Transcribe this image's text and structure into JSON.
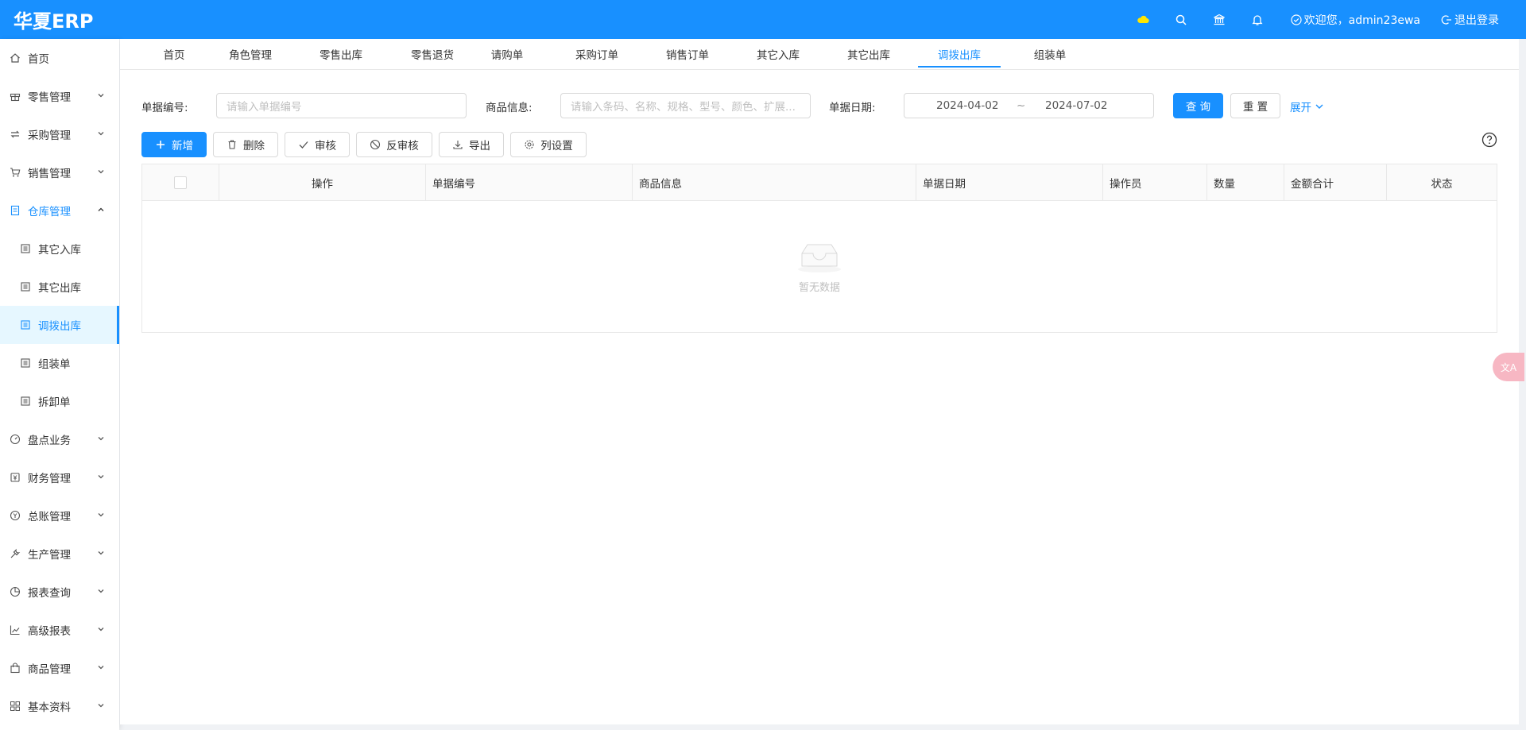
{
  "header": {
    "logo": "华夏ERP",
    "welcome": "欢迎您，admin23ewa",
    "logout": "退出登录",
    "icons": [
      "cloud-icon",
      "search-icon",
      "bank-icon",
      "bell-icon"
    ]
  },
  "sidebar": {
    "items": [
      {
        "label": "首页",
        "icon": "home-icon"
      },
      {
        "label": "零售管理",
        "icon": "gift-icon"
      },
      {
        "label": "采购管理",
        "icon": "swap-icon"
      },
      {
        "label": "销售管理",
        "icon": "cart-icon"
      },
      {
        "label": "仓库管理",
        "icon": "file-icon"
      },
      {
        "label": "盘点业务",
        "icon": "dashboard-icon"
      },
      {
        "label": "财务管理",
        "icon": "money-icon"
      },
      {
        "label": "总账管理",
        "icon": "money-collect-icon"
      },
      {
        "label": "生产管理",
        "icon": "tool-icon"
      },
      {
        "label": "报表查询",
        "icon": "pie-chart-icon"
      },
      {
        "label": "高级报表",
        "icon": "line-chart-icon"
      },
      {
        "label": "商品管理",
        "icon": "shopping-icon"
      },
      {
        "label": "基本资料",
        "icon": "appstore-icon"
      }
    ],
    "warehouse_sub": [
      {
        "label": "其它入库"
      },
      {
        "label": "其它出库"
      },
      {
        "label": "调拨出库"
      },
      {
        "label": "组装单"
      },
      {
        "label": "拆卸单"
      }
    ]
  },
  "tabs": [
    "首页",
    "角色管理",
    "零售出库",
    "零售退货",
    "请购单",
    "采购订单",
    "销售订单",
    "其它入库",
    "其它出库",
    "调拨出库",
    "组装单"
  ],
  "search": {
    "bill_no_label": "单据编号:",
    "bill_no_placeholder": "请输入单据编号",
    "goods_label": "商品信息:",
    "goods_placeholder": "请输入条码、名称、规格、型号、颜色、扩展...",
    "date_label": "单据日期:",
    "date_start": "2024-04-02",
    "date_sep": "~",
    "date_end": "2024-07-02",
    "query": "查 询",
    "reset": "重 置",
    "expand": "展开"
  },
  "toolbar": {
    "add": "新增",
    "delete": "删除",
    "audit": "审核",
    "unaudit": "反审核",
    "export": "导出",
    "columns": "列设置"
  },
  "table": {
    "columns": [
      "操作",
      "单据编号",
      "商品信息",
      "单据日期",
      "操作员",
      "数量",
      "金额合计",
      "状态"
    ],
    "empty": "暂无数据"
  },
  "float": {
    "label": "文A"
  }
}
